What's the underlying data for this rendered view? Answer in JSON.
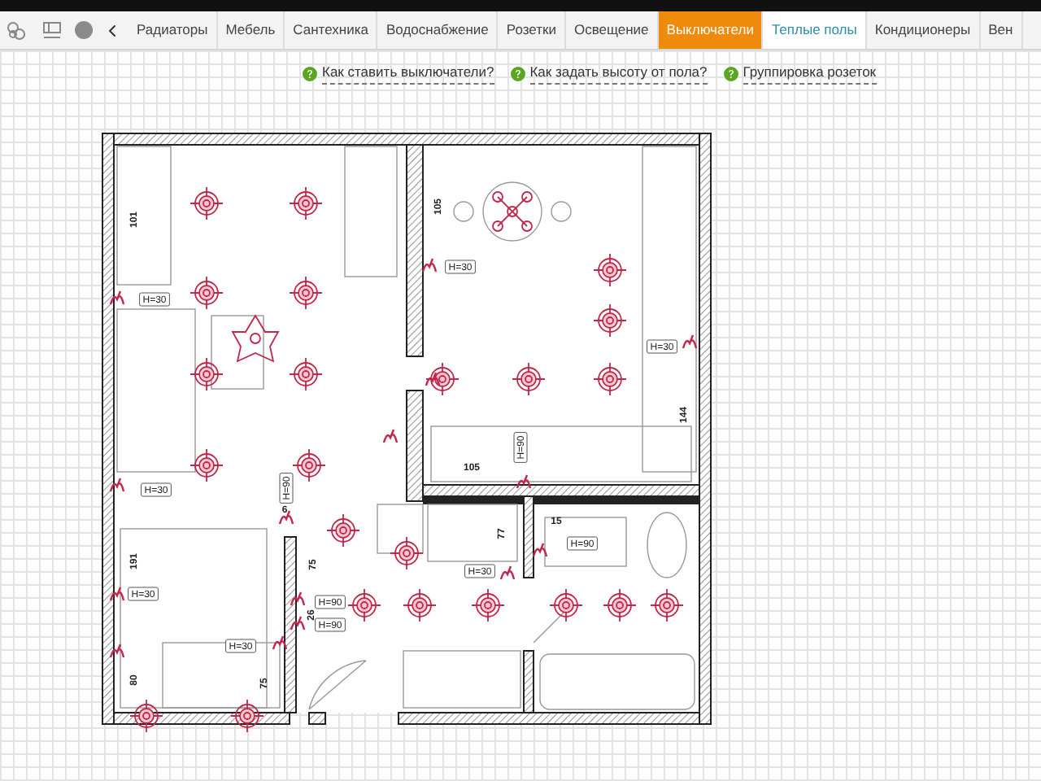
{
  "toolbar": {
    "tabs": [
      {
        "label": "Радиаторы",
        "selected": false,
        "hovered": false
      },
      {
        "label": "Мебель",
        "selected": false,
        "hovered": false
      },
      {
        "label": "Сантехника",
        "selected": false,
        "hovered": false
      },
      {
        "label": "Водоснабжение",
        "selected": false,
        "hovered": false
      },
      {
        "label": "Розетки",
        "selected": false,
        "hovered": false
      },
      {
        "label": "Освещение",
        "selected": false,
        "hovered": false
      },
      {
        "label": "Выключатели",
        "selected": true,
        "hovered": false
      },
      {
        "label": "Теплые полы",
        "selected": false,
        "hovered": true
      },
      {
        "label": "Кондиционеры",
        "selected": false,
        "hovered": false
      },
      {
        "label": "Вен",
        "selected": false,
        "hovered": false
      }
    ]
  },
  "help_links": [
    "Как ставить выключатели?",
    "Как задать высоту от пола?",
    "Группировка розеток"
  ],
  "plan": {
    "labels": [
      {
        "text": "101",
        "kind": "dimension"
      },
      {
        "text": "H=30",
        "kind": "height"
      },
      {
        "text": "105",
        "kind": "dimension"
      },
      {
        "text": "H=30",
        "kind": "height"
      },
      {
        "text": "H=30",
        "kind": "height"
      },
      {
        "text": "144",
        "kind": "dimension"
      },
      {
        "text": "H=90",
        "kind": "height"
      },
      {
        "text": "105",
        "kind": "dimension"
      },
      {
        "text": "H=30",
        "kind": "height"
      },
      {
        "text": "H=90",
        "kind": "height"
      },
      {
        "text": "6",
        "kind": "dimension"
      },
      {
        "text": "15",
        "kind": "dimension"
      },
      {
        "text": "77",
        "kind": "dimension"
      },
      {
        "text": "H=90",
        "kind": "height"
      },
      {
        "text": "75",
        "kind": "dimension"
      },
      {
        "text": "H=30",
        "kind": "height"
      },
      {
        "text": "191",
        "kind": "dimension"
      },
      {
        "text": "H=30",
        "kind": "height"
      },
      {
        "text": "H=90",
        "kind": "height"
      },
      {
        "text": "26",
        "kind": "dimension"
      },
      {
        "text": "H=90",
        "kind": "height"
      },
      {
        "text": "H=30",
        "kind": "height"
      },
      {
        "text": "80",
        "kind": "dimension"
      },
      {
        "text": "75",
        "kind": "dimension"
      }
    ]
  }
}
